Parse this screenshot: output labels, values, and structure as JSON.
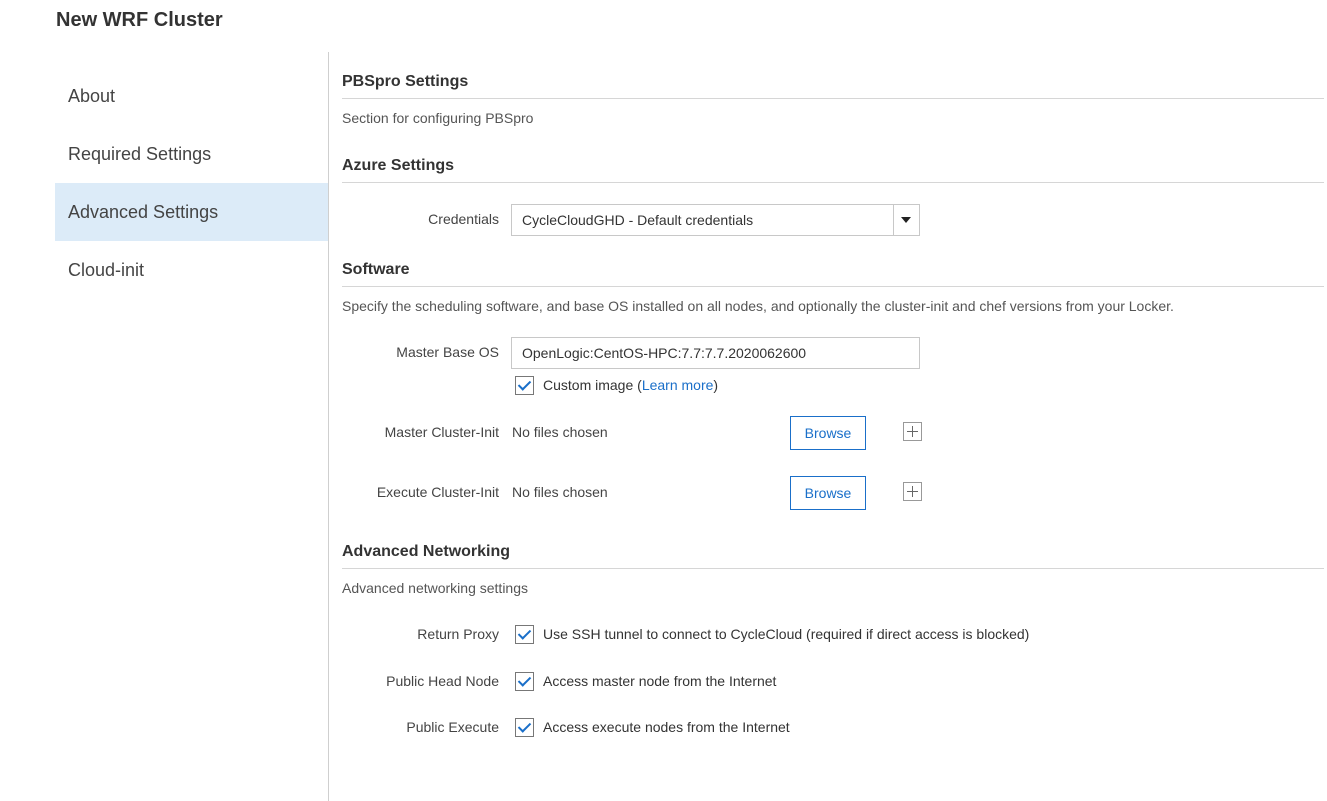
{
  "page_title": "New WRF Cluster",
  "sidebar": {
    "items": [
      {
        "label": "About",
        "active": false
      },
      {
        "label": "Required Settings",
        "active": false
      },
      {
        "label": "Advanced Settings",
        "active": true
      },
      {
        "label": "Cloud-init",
        "active": false
      }
    ]
  },
  "sections": {
    "pbspro": {
      "title": "PBSpro Settings",
      "description": "Section for configuring PBSpro"
    },
    "azure": {
      "title": "Azure Settings",
      "credentials_label": "Credentials",
      "credentials_value": "CycleCloudGHD - Default credentials"
    },
    "software": {
      "title": "Software",
      "description": "Specify the scheduling software, and base OS installed on all nodes, and optionally the cluster-init and chef versions from your Locker.",
      "master_os_label": "Master Base OS",
      "master_os_value": "OpenLogic:CentOS-HPC:7.7:7.7.2020062600",
      "custom_image_label": "Custom image (",
      "learn_more": "Learn more",
      "custom_image_close": ")",
      "custom_image_checked": true,
      "master_init_label": "Master Cluster-Init",
      "master_init_value": "No files chosen",
      "execute_init_label": "Execute Cluster-Init",
      "execute_init_value": "No files chosen",
      "browse_label": "Browse"
    },
    "networking": {
      "title": "Advanced Networking",
      "description": "Advanced networking settings",
      "return_proxy_label": "Return Proxy",
      "return_proxy_text": "Use SSH tunnel to connect to CycleCloud (required if direct access is blocked)",
      "public_head_label": "Public Head Node",
      "public_head_text": "Access master node from the Internet",
      "public_execute_label": "Public Execute",
      "public_execute_text": "Access execute nodes from the Internet"
    }
  },
  "colors": {
    "accent": "#1a6fc9",
    "active_nav": "#dcebf8"
  }
}
